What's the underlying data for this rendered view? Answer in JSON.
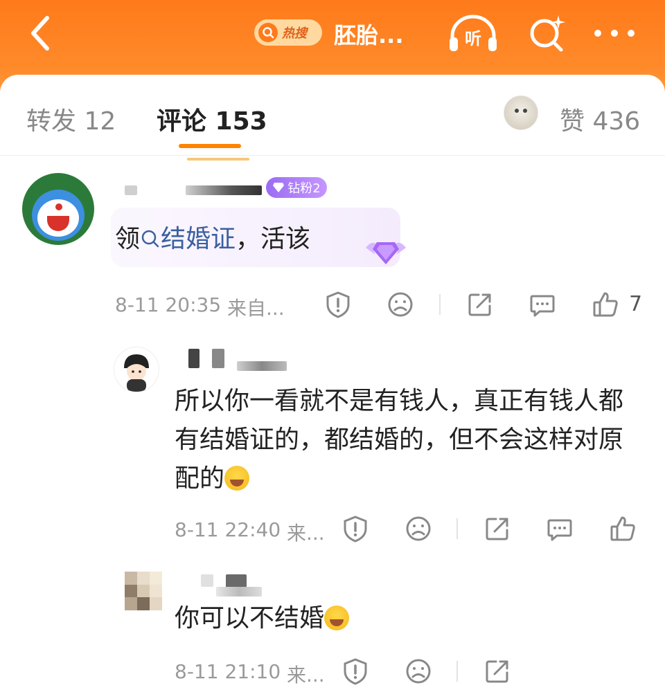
{
  "topbar": {
    "back_icon": "chevron-left-icon",
    "hot_label": "热搜",
    "title": "胚胎...",
    "listen_label": "听",
    "search_icon": "search-sparkle-icon",
    "more_icon": "more-dots-icon",
    "accent": "#ff7a1a"
  },
  "tabs": {
    "repost": "转发 12",
    "comments": "评论 153",
    "likes": "赞 436"
  },
  "comments": [
    {
      "badge": "钻粉2",
      "text_before": "领",
      "topic": "结婚证",
      "text_after": "，活该",
      "time": "8-11 20:35",
      "source": "来自...",
      "like_count": "7"
    }
  ],
  "replies": [
    {
      "text": "所以你一看就不是有钱人，真正有钱人都有结婚证的，都结婚的，但不会这样对原配的",
      "emoji": "laugh-cry-emoji",
      "time": "8-11 22:40",
      "source": "来..."
    },
    {
      "text": "你可以不结婚",
      "emoji": "laugh-cry-emoji",
      "time": "8-11 21:10",
      "source": "来..."
    }
  ],
  "colors": {
    "topic_link": "#3b5fa0",
    "badge_purple": "#9b6cf2",
    "tab_underline": "#ff8200"
  }
}
